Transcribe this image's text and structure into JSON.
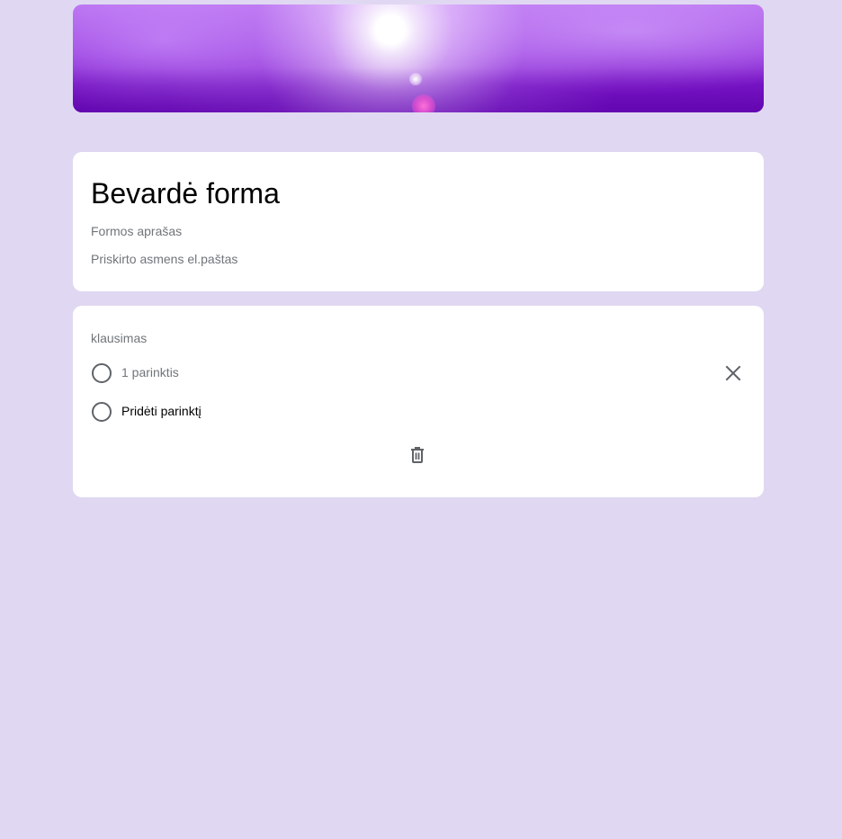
{
  "form": {
    "title": "Bevardė forma",
    "description_placeholder": "Formos aprašas",
    "email_placeholder": "Priskirto asmens el.paštas"
  },
  "question": {
    "label": "klausimas",
    "options": [
      {
        "label": "1 parinktis"
      },
      {
        "label": "Pridėti parinktį"
      }
    ]
  },
  "icons": {
    "remove_option": "close-icon",
    "delete_question": "trash-icon"
  },
  "colors": {
    "background": "#e0d8f2",
    "header_accent": "#7a16c8",
    "card": "#ffffff",
    "muted_text": "#70757a",
    "icon": "#5f6368"
  }
}
